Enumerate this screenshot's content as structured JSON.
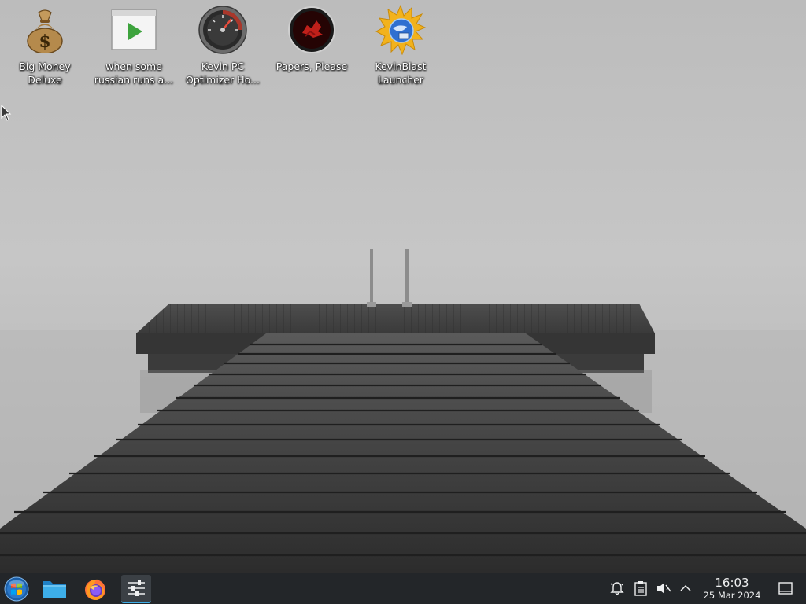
{
  "desktop": {
    "icons": [
      {
        "label": "Big Money\nDeluxe",
        "icon": "money-bag-icon"
      },
      {
        "label": "when some\nrussian runs a...",
        "icon": "video-play-icon"
      },
      {
        "label": "Kevin PC\nOptimizer Ho...",
        "icon": "speedometer-icon"
      },
      {
        "label": "Papers, Please",
        "icon": "papers-please-icon"
      },
      {
        "label": "KevinBlast\nLauncher",
        "icon": "sun-globe-icon"
      }
    ]
  },
  "taskbar": {
    "launchers": [
      {
        "name": "start-menu",
        "icon": "windows-orb-icon"
      },
      {
        "name": "file-manager",
        "icon": "folder-icon"
      },
      {
        "name": "firefox",
        "icon": "firefox-icon"
      },
      {
        "name": "system-settings",
        "icon": "sliders-icon"
      }
    ],
    "tray": [
      "notifications-icon",
      "clipboard-icon",
      "volume-muted-icon",
      "chevron-up-icon",
      "show-desktop-icon"
    ],
    "clock": {
      "time": "16:03",
      "date": "25 Mar 2024"
    }
  },
  "colors": {
    "taskbar_bg": "#232629",
    "taskbar_text": "#eff0f1",
    "accent": "#3daee9",
    "icon_label": "#ffffff"
  }
}
